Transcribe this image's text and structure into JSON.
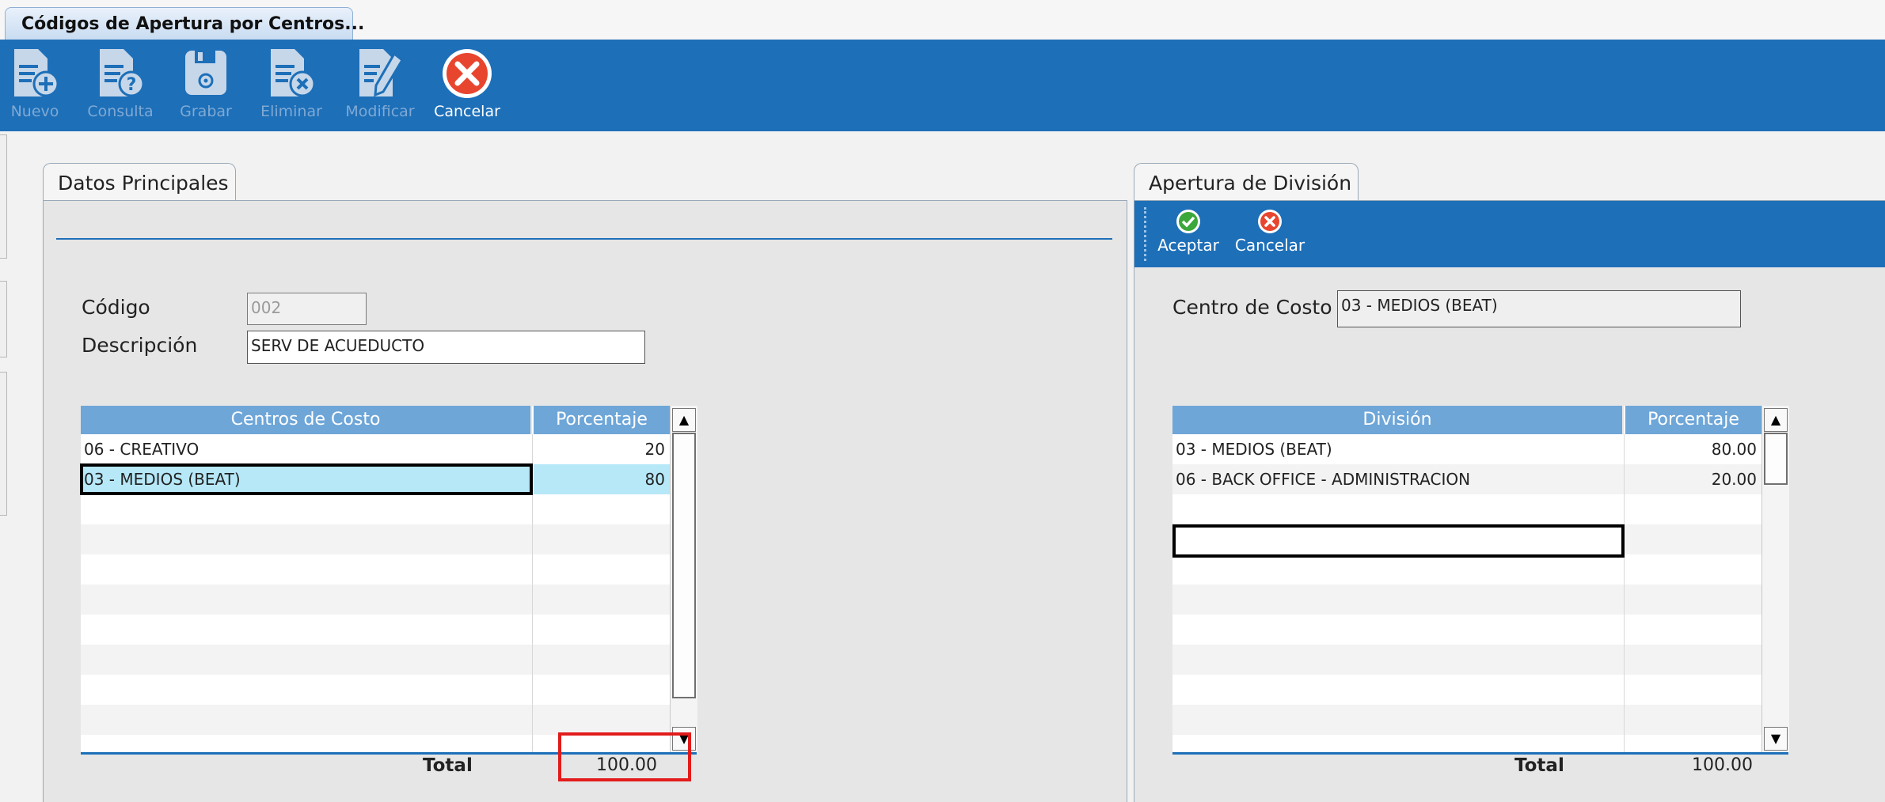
{
  "window": {
    "tab_title": "Códigos de Apertura por Centros..."
  },
  "toolbar": {
    "items": [
      {
        "label": "Nuevo",
        "icon": "document-add-icon",
        "enabled": false
      },
      {
        "label": "Consulta",
        "icon": "document-query-icon",
        "enabled": false
      },
      {
        "label": "Grabar",
        "icon": "save-icon",
        "enabled": false
      },
      {
        "label": "Eliminar",
        "icon": "document-delete-icon",
        "enabled": false
      },
      {
        "label": "Modificar",
        "icon": "document-edit-icon",
        "enabled": false
      },
      {
        "label": "Cancelar",
        "icon": "cancel-icon",
        "enabled": true
      }
    ]
  },
  "main": {
    "tab": "Datos Principales",
    "codigo": {
      "label": "Código",
      "value": "002"
    },
    "descripcion": {
      "label": "Descripción",
      "value": "SERV DE ACUEDUCTO"
    },
    "grid": {
      "columns": [
        "Centros de Costo",
        "Porcentaje"
      ],
      "rows": [
        {
          "centro": "06 - CREATIVO",
          "porcentaje": "20"
        },
        {
          "centro": "03 - MEDIOS (BEAT)",
          "porcentaje": "80"
        }
      ],
      "selected_row": 1,
      "total_label": "Total",
      "total_value": "100.00"
    }
  },
  "division": {
    "tab": "Apertura de División",
    "toolbar": {
      "accept_label": "Aceptar",
      "cancel_label": "Cancelar"
    },
    "centro": {
      "label": "Centro de Costo",
      "value": "03 - MEDIOS (BEAT)"
    },
    "grid": {
      "columns": [
        "División",
        "Porcentaje"
      ],
      "rows": [
        {
          "division": "03 - MEDIOS (BEAT)",
          "porcentaje": "80.00"
        },
        {
          "division": "06 - BACK OFFICE - ADMINISTRACION",
          "porcentaje": "20.00"
        }
      ],
      "total_label": "Total",
      "total_value": "100.00"
    }
  },
  "colors": {
    "toolbar_bg": "#1d6fb8",
    "grid_header": "#6ea6d8",
    "selection": "#b6e8f8",
    "highlight_box": "#e21b1b"
  }
}
